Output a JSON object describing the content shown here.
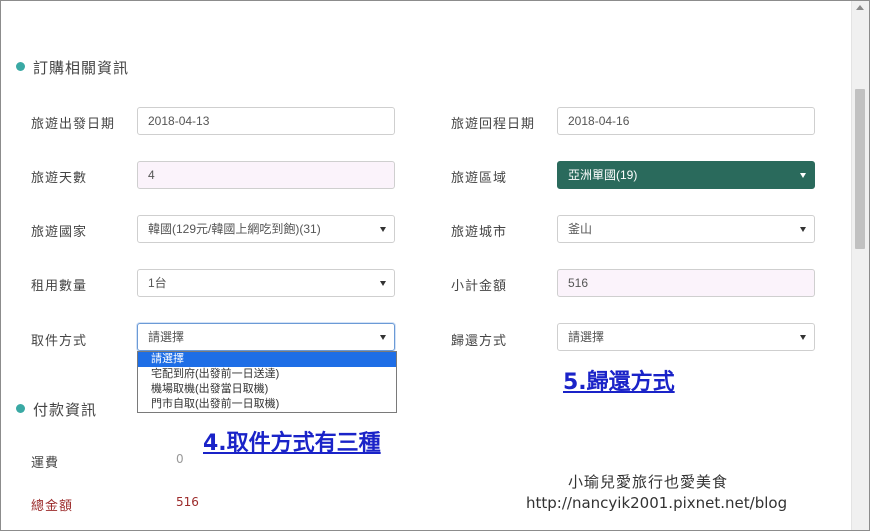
{
  "order_section": {
    "title": "訂購相關資訊"
  },
  "payment_section": {
    "title": "付款資訊"
  },
  "fields": {
    "depart_date": {
      "label": "旅遊出發日期",
      "value": "2018-04-13"
    },
    "return_date": {
      "label": "旅遊回程日期",
      "value": "2018-04-16"
    },
    "days": {
      "label": "旅遊天數",
      "value": "4"
    },
    "region": {
      "label": "旅遊區域",
      "value": "亞洲單國(19)"
    },
    "country": {
      "label": "旅遊國家",
      "value": "韓國(129元/韓國上網吃到飽)(31)"
    },
    "city": {
      "label": "旅遊城市",
      "value": "釜山"
    },
    "quantity": {
      "label": "租用數量",
      "value": "1台"
    },
    "subtotal": {
      "label": "小計金額",
      "value": "516"
    },
    "pickup": {
      "label": "取件方式",
      "value": "請選擇",
      "options": [
        "請選擇",
        "宅配到府(出發前一日送達)",
        "機場取機(出發當日取機)",
        "門市自取(出發前一日取機)"
      ]
    },
    "return_method": {
      "label": "歸還方式",
      "value": "請選擇"
    }
  },
  "payment": {
    "shipping_label": "運費",
    "shipping_value": "0",
    "total_label": "總金額",
    "total_value": "516"
  },
  "annotations": {
    "pickup_note": "4.取件方式有三種",
    "return_note": "5.歸還方式"
  },
  "watermark": {
    "line1": "小瑜兒愛旅行也愛美食",
    "line2": "http://nancyik2001.pixnet.net/blog"
  },
  "colors": {
    "accent_dot": "#3aa9a4",
    "region_select_bg": "#2a6a5c",
    "annotation_blue": "#1a23c8",
    "total_red": "#9c2b2b",
    "dropdown_highlight": "#1e6ee6"
  }
}
